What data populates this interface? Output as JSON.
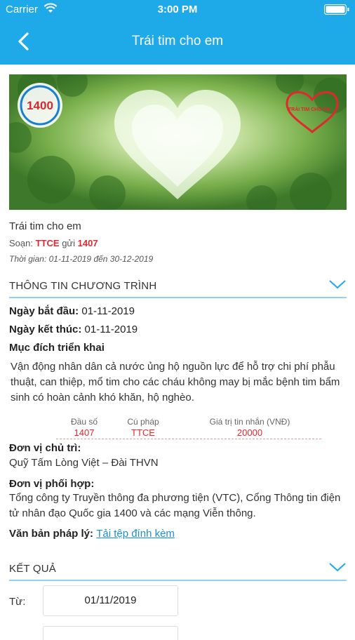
{
  "status_bar": {
    "carrier": "Carrier",
    "time": "3:00 PM"
  },
  "nav": {
    "title": "Trái tim cho em"
  },
  "program": {
    "name": "Trái tim cho em",
    "syntax_prefix": "Soạn:",
    "syntax_code": "TTCE",
    "syntax_mid": "gửi",
    "syntax_number": "1407",
    "period": "Thời gian: 01-11-2019 đến 30-12-2019",
    "banner_logo_left": "1400",
    "banner_logo_right": "TRÁI TIM CHO EM"
  },
  "info_section": {
    "title": "THÔNG TIN CHƯƠNG TRÌNH",
    "start_label": "Ngày bắt đầu:",
    "start_value": "01-11-2019",
    "end_label": "Ngày kết thúc:",
    "end_value": "01-11-2019",
    "purpose_label": "Mục đích triển khai",
    "purpose_text": "Vận động nhân dân cả nước ủng hộ nguồn lực để hỗ trợ chi phí phẫu thuật, can thiệp, mổ tim cho các cháu không may bị mắc bệnh tim bẩm sinh có hoàn cảnh khó khăn, hộ nghèo.",
    "stats": [
      {
        "label": "Đầu số",
        "value": "1407"
      },
      {
        "label": "Cú pháp",
        "value": "TTCE"
      },
      {
        "label": "Giá trị tin nhắn (VNĐ)",
        "value": "20000"
      }
    ],
    "host_label": "Đơn vị chủ trì:",
    "host_value": "Quỹ Tấm Lòng Việt – Đài THVN",
    "partner_label": "Đơn vị phối hợp:",
    "partner_value": "Tổng công ty Truyền thông đa phương tiện (VTC), Cổng Thông tin điện tử nhân đạo Quốc gia 1400 và các mạng Viễn thông.",
    "legal_label": "Văn bản pháp lý:",
    "legal_link": "Tải tệp đính kèm"
  },
  "result_section": {
    "title": "KẾT QUẢ",
    "from_label": "Từ:",
    "from_value": "01/11/2019"
  },
  "colors": {
    "primary": "#1ea9e9",
    "accent_red": "#e0282f",
    "link": "#1a8fd6"
  }
}
